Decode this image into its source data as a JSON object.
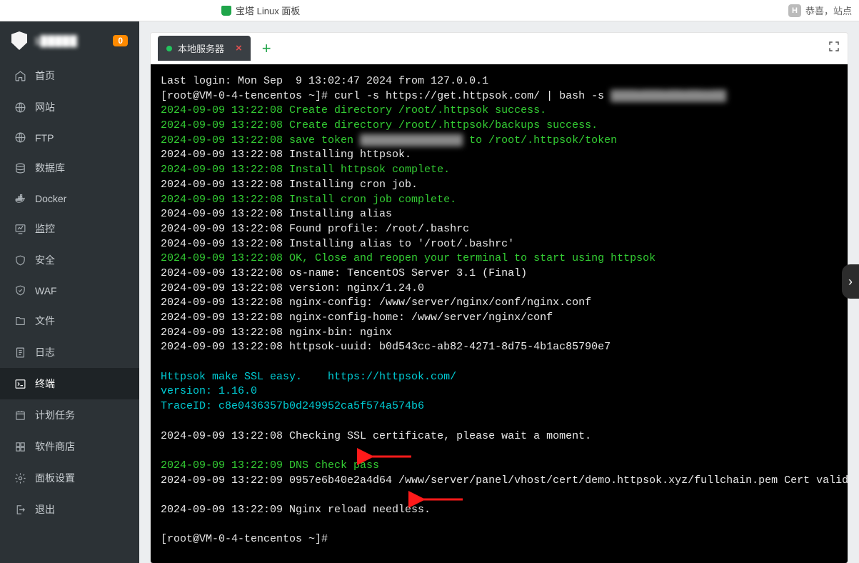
{
  "topbar": {
    "title": "宝塔 Linux 面板",
    "right_text": "恭喜，站点"
  },
  "sidebar": {
    "title": "1█████",
    "badge": "0",
    "items": [
      {
        "key": "home",
        "label": "首页"
      },
      {
        "key": "site",
        "label": "网站"
      },
      {
        "key": "ftp",
        "label": "FTP"
      },
      {
        "key": "db",
        "label": "数据库"
      },
      {
        "key": "docker",
        "label": "Docker"
      },
      {
        "key": "monitor",
        "label": "监控"
      },
      {
        "key": "security",
        "label": "安全"
      },
      {
        "key": "waf",
        "label": "WAF"
      },
      {
        "key": "files",
        "label": "文件"
      },
      {
        "key": "logs",
        "label": "日志"
      },
      {
        "key": "terminal",
        "label": "终端",
        "active": true
      },
      {
        "key": "cron",
        "label": "计划任务"
      },
      {
        "key": "store",
        "label": "软件商店"
      },
      {
        "key": "settings",
        "label": "面板设置"
      },
      {
        "key": "logout",
        "label": "退出"
      }
    ]
  },
  "terminal_tab": {
    "label": "本地服务器"
  },
  "terminal_lines": [
    {
      "t": "Last login: Mon Sep  9 13:02:47 2024 from 127.0.0.1"
    },
    {
      "t": "[root@VM-0-4-tencentos ~]# curl -s https://get.httpsok.com/ | bash -s ",
      "mask": "████ ███ ██ ██  ██"
    },
    {
      "c": "g",
      "t": "2024-09-09 13:22:08 Create directory /root/.httpsok success."
    },
    {
      "c": "g",
      "t": "2024-09-09 13:22:08 Create directory /root/.httpsok/backups success."
    },
    {
      "c": "g",
      "t": "2024-09-09 13:22:08 save token ",
      "mask": "████████████████",
      "tail": " to /root/.httpsok/token"
    },
    {
      "t": "2024-09-09 13:22:08 Installing httpsok."
    },
    {
      "c": "g",
      "t": "2024-09-09 13:22:08 Install httpsok complete."
    },
    {
      "t": "2024-09-09 13:22:08 Installing cron job."
    },
    {
      "c": "g",
      "t": "2024-09-09 13:22:08 Install cron job complete."
    },
    {
      "t": "2024-09-09 13:22:08 Installing alias"
    },
    {
      "t": "2024-09-09 13:22:08 Found profile: /root/.bashrc"
    },
    {
      "t": "2024-09-09 13:22:08 Installing alias to '/root/.bashrc'"
    },
    {
      "c": "g",
      "t": "2024-09-09 13:22:08 OK, Close and reopen your terminal to start using httpsok"
    },
    {
      "t": "2024-09-09 13:22:08 os-name: TencentOS Server 3.1 (Final)"
    },
    {
      "t": "2024-09-09 13:22:08 version: nginx/1.24.0"
    },
    {
      "t": "2024-09-09 13:22:08 nginx-config: /www/server/nginx/conf/nginx.conf"
    },
    {
      "t": "2024-09-09 13:22:08 nginx-config-home: /www/server/nginx/conf"
    },
    {
      "t": "2024-09-09 13:22:08 nginx-bin: nginx"
    },
    {
      "t": "2024-09-09 13:22:08 httpsok-uuid: b0d543cc-ab82-4271-8d75-4b1ac85790e7"
    },
    {
      "t": ""
    },
    {
      "c": "c",
      "t": "Httpsok make SSL easy.    https://httpsok.com/"
    },
    {
      "c": "c",
      "t": "version: 1.16.0"
    },
    {
      "c": "c",
      "t": "TraceID: c8e0436357b0d249952ca5f574a574b6"
    },
    {
      "t": ""
    },
    {
      "t": "2024-09-09 13:22:08 Checking SSL certificate, please wait a moment."
    },
    {
      "t": ""
    },
    {
      "c": "g",
      "t": "2024-09-09 13:22:09 DNS check pass"
    },
    {
      "t": "2024-09-09 13:22:09 0957e6b40e2a4d64 /www/server/panel/vhost/cert/demo.httpsok.xyz/fullchain.pem Cert valid"
    },
    {
      "t": ""
    },
    {
      "t": "2024-09-09 13:22:09 Nginx reload needless."
    },
    {
      "t": ""
    },
    {
      "t": "[root@VM-0-4-tencentos ~]#"
    }
  ]
}
